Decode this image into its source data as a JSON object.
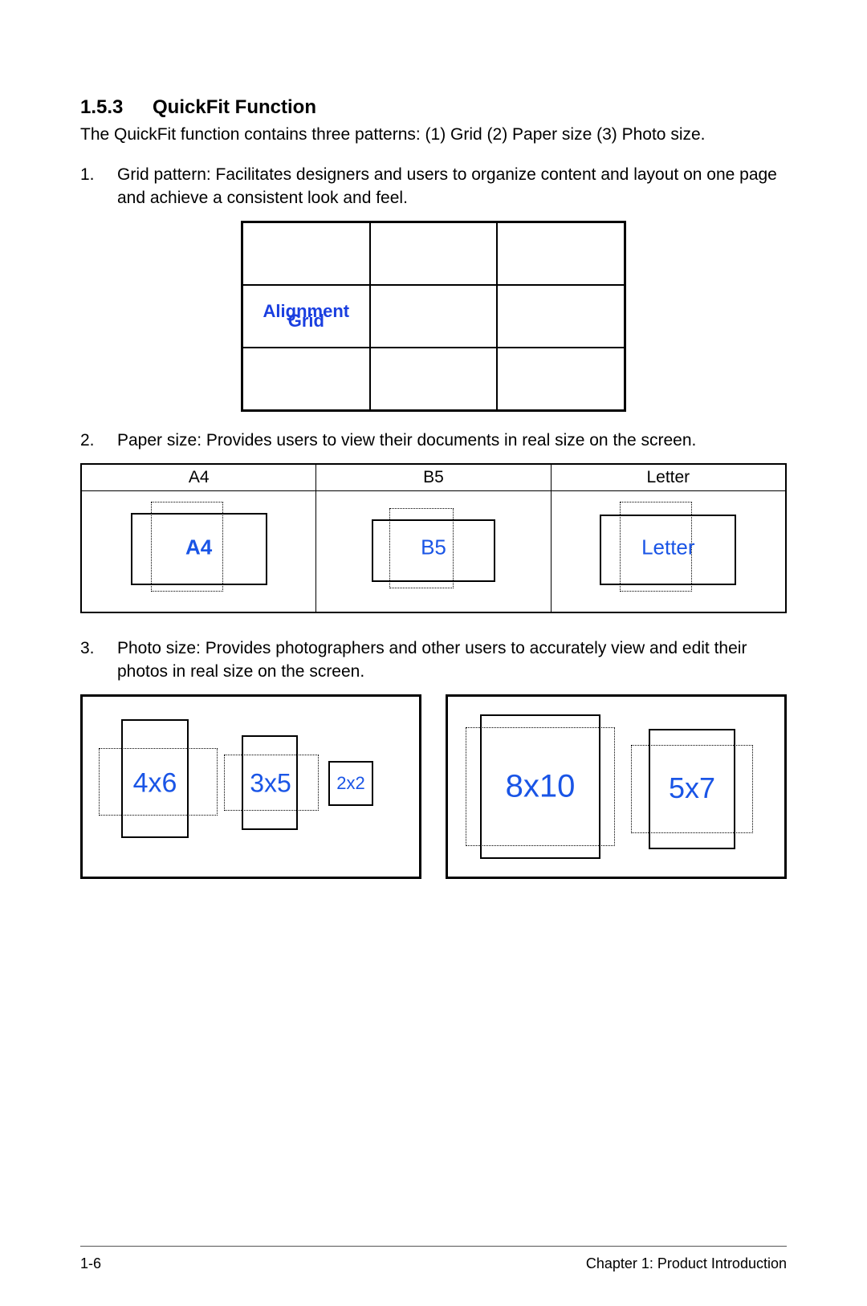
{
  "heading_num": "1.5.3",
  "heading_title": "QuickFit Function",
  "intro": "The QuickFit function contains three patterns: (1) Grid (2) Paper size (3) Photo size.",
  "items": [
    {
      "num": "1.",
      "text": "Grid pattern: Facilitates designers and users to organize content and layout on one page and achieve a consistent look and feel."
    },
    {
      "num": "2.",
      "text": "Paper size: Provides users to view their documents in real size on the screen."
    },
    {
      "num": "3.",
      "text": "Photo size: Provides photographers and other users to accurately view and edit their photos in real size on the screen."
    }
  ],
  "grid_label_line1": "Alignment",
  "grid_label_line2": "Grid",
  "paper_headers": {
    "a4": "A4",
    "b5": "B5",
    "letter": "Letter"
  },
  "paper_labels": {
    "a4": "A4",
    "b5": "B5",
    "letter": "Letter"
  },
  "photo_labels": {
    "p4x6": "4x6",
    "p3x5": "3x5",
    "p2x2": "2x2",
    "p8x10": "8x10",
    "p5x7": "5x7"
  },
  "footer_left": "1-6",
  "footer_right": "Chapter 1: Product Introduction"
}
